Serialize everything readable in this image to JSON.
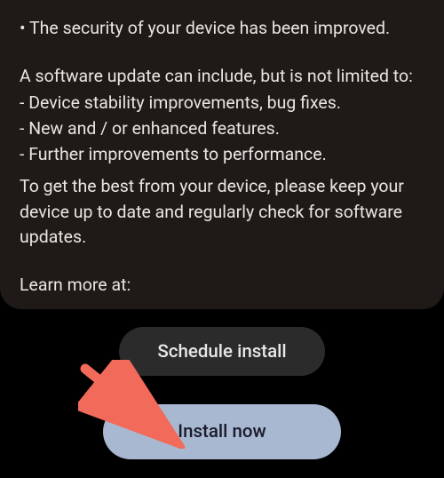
{
  "content": {
    "bullet1": "• The security of your device has been improved.",
    "intro": "A software update can include, but is not limited to:",
    "item1": " - Device stability improvements, bug fixes.",
    "item2": " - New and / or enhanced features.",
    "item3": " - Further improvements to performance.",
    "best": "To get the best from your device, please keep your device up to date and regularly check for software updates.",
    "learn": "Learn more at:"
  },
  "buttons": {
    "schedule_label": "Schedule install",
    "install_label": "Install now"
  }
}
